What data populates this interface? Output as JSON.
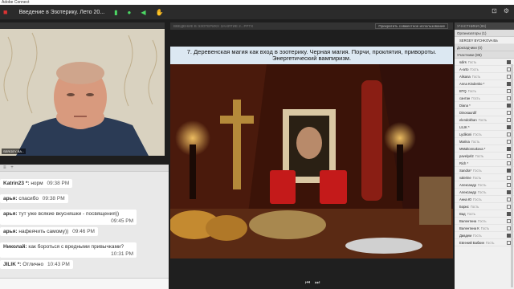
{
  "app": {
    "title": "Adobe Connect"
  },
  "menubar": {
    "room_title": "Введение в Эзотерику. Лето 20...",
    "right_icons": [
      "minimize-icon",
      "maximize-icon",
      "close-icon"
    ]
  },
  "video": {
    "header": "SERGEY BA...",
    "name_label": "SERGEY BA..."
  },
  "share": {
    "header_title": "ВВЕДЕНИЕ В ЭЗОТЕРИКУ. ЗАНЯТИЕ 2...PPTX",
    "coop_button": "Прекратить совместное использование",
    "slide_title_line1": "7. Деревенская магия как вход в эзотерику. Черная магия. Порчи, проклятия, привороты.",
    "slide_title_line2": "Энергетический вампиризм."
  },
  "chat": {
    "messages": [
      {
        "author": "Katrin23 *:",
        "text": "норм",
        "time": "09:38 PM"
      },
      {
        "author": "арья:",
        "text": "спасибо",
        "time": "09:38 PM"
      },
      {
        "author": "арья:",
        "text": "тут уже всякие вкусняшки - посвящения))",
        "time": "09:45 PM"
      },
      {
        "author": "арья:",
        "text": "нафеячить самому))",
        "time": "09:46 PM"
      },
      {
        "author": "Николай:",
        "text": "как бороться с вредными привычками?",
        "time": "10:31 PM"
      },
      {
        "author": "JILIK *:",
        "text": "Отлично",
        "time": "10:43 PM"
      }
    ]
  },
  "attendees": {
    "header": "УЧАСТНИКИ (86)",
    "organizers_label": "Организаторы (1)",
    "organizer": "SERGEY BYCHKOVA Ва",
    "presenters_label": "Докладчики (0)",
    "participants_label": "Участники (85)",
    "list": [
      {
        "name": "sdirs",
        "status": "Гость"
      },
      {
        "name": "A-arto",
        "status": "Гость"
      },
      {
        "name": "Alisana",
        "status": "Гость"
      },
      {
        "name": "Anna Kindenko *",
        "status": ""
      },
      {
        "name": "BTQ",
        "status": "Гость"
      },
      {
        "name": "сантан",
        "status": "Гость"
      },
      {
        "name": "Diana *",
        "status": ""
      },
      {
        "name": "Dinosaurdif",
        "status": ""
      },
      {
        "name": "elendokhan",
        "status": "Гость"
      },
      {
        "name": "LILIK *",
        "status": ""
      },
      {
        "name": "Lydikoni",
        "status": "Гость"
      },
      {
        "name": "Marina",
        "status": "Гость"
      },
      {
        "name": "MMaltonnakova *",
        "status": ""
      },
      {
        "name": "pavelyel2",
        "status": "Гость"
      },
      {
        "name": "Rich *",
        "status": ""
      },
      {
        "name": "Sandra*",
        "status": "Гость"
      },
      {
        "name": "valerine",
        "status": "Гость"
      },
      {
        "name": "Александр",
        "status": "Гость"
      },
      {
        "name": "Александр",
        "status": "Гость"
      },
      {
        "name": "Анна Ю",
        "status": "Гость"
      },
      {
        "name": "Борис",
        "status": "Гость"
      },
      {
        "name": "Вад",
        "status": "Гость"
      },
      {
        "name": "Валентина",
        "status": "Гость"
      },
      {
        "name": "Валентина К",
        "status": "Гость"
      },
      {
        "name": "Диадем",
        "status": "Гость"
      },
      {
        "name": "Евгений Бабкин",
        "status": "Гость"
      }
    ]
  }
}
